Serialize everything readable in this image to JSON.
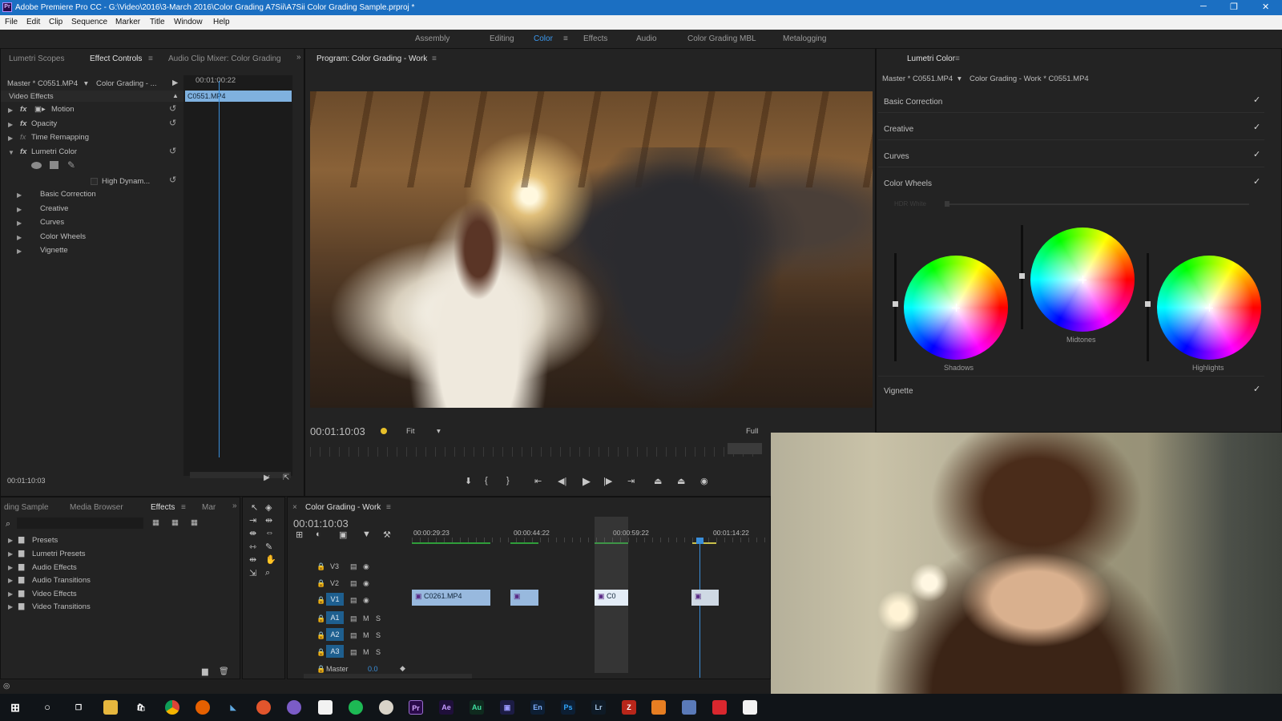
{
  "window": {
    "title": "Adobe Premiere Pro CC - G:\\Video\\2016\\3-March 2016\\Color Grading A7Sii\\A7Sii Color Grading Sample.prproj *",
    "logo": "Pr",
    "controls": [
      "─",
      "❐",
      "✕"
    ]
  },
  "menu": [
    "File",
    "Edit",
    "Clip",
    "Sequence",
    "Marker",
    "Title",
    "Window",
    "Help"
  ],
  "workspaces": {
    "items": [
      "Assembly",
      "Editing",
      "Color",
      "Effects",
      "Audio",
      "Color Grading MBL",
      "Metalogging"
    ],
    "active": "Color"
  },
  "effect_controls": {
    "tabs": [
      "Lumetri Scopes",
      "Effect Controls",
      "Audio Clip Mixer: Color Grading"
    ],
    "active_tab": "Effect Controls",
    "master": "Master * C0551.MP4",
    "sequence": "Color Grading - ...",
    "timecode_top": "00:01:00:22",
    "clip": "C0551.MP4",
    "section": "Video Effects",
    "effects": [
      "Motion",
      "Opacity",
      "Time Remapping",
      "Lumetri Color"
    ],
    "hdr": "High Dynam...",
    "lumetri_sections": [
      "Basic Correction",
      "Creative",
      "Curves",
      "Color Wheels",
      "Vignette"
    ],
    "timecode_bottom": "00:01:10:03"
  },
  "program": {
    "title": "Program: Color Grading - Work",
    "timecode": "00:01:10:03",
    "fit": "Fit",
    "quality": "Full"
  },
  "lumetri": {
    "title": "Lumetri Color",
    "master": "Master * C0551.MP4",
    "sequence": "Color Grading - Work * C0551.MP4",
    "sections": [
      "Basic Correction",
      "Creative",
      "Curves",
      "Color Wheels"
    ],
    "hdr": "HDR White",
    "wheels": [
      "Shadows",
      "Midtones",
      "Highlights"
    ],
    "vignette": "Vignette",
    "colors": {
      "accent": "#2d8ceb"
    }
  },
  "project": {
    "tabs": [
      "ding Sample",
      "Media Browser",
      "Effects",
      "Mar"
    ],
    "active_tab": "Effects",
    "folders": [
      "Presets",
      "Lumetri Presets",
      "Audio Effects",
      "Audio Transitions",
      "Video Effects",
      "Video Transitions"
    ]
  },
  "timeline": {
    "title": "Color Grading - Work",
    "timecode": "00:01:10:03",
    "ruler": [
      "00:00:29:23",
      "00:00:44:22",
      "00:00:59:22",
      "00:01:14:22"
    ],
    "video_tracks": [
      "V3",
      "V2",
      "V1"
    ],
    "audio_tracks": [
      "A1",
      "A2",
      "A3"
    ],
    "master": "Master",
    "master_value": "0.0",
    "clips": [
      "C0261.MP4",
      "C0"
    ]
  },
  "taskbar": {
    "apps": [
      "Pr",
      "Ae",
      "Au",
      "En",
      "Ps",
      "Lr"
    ]
  }
}
